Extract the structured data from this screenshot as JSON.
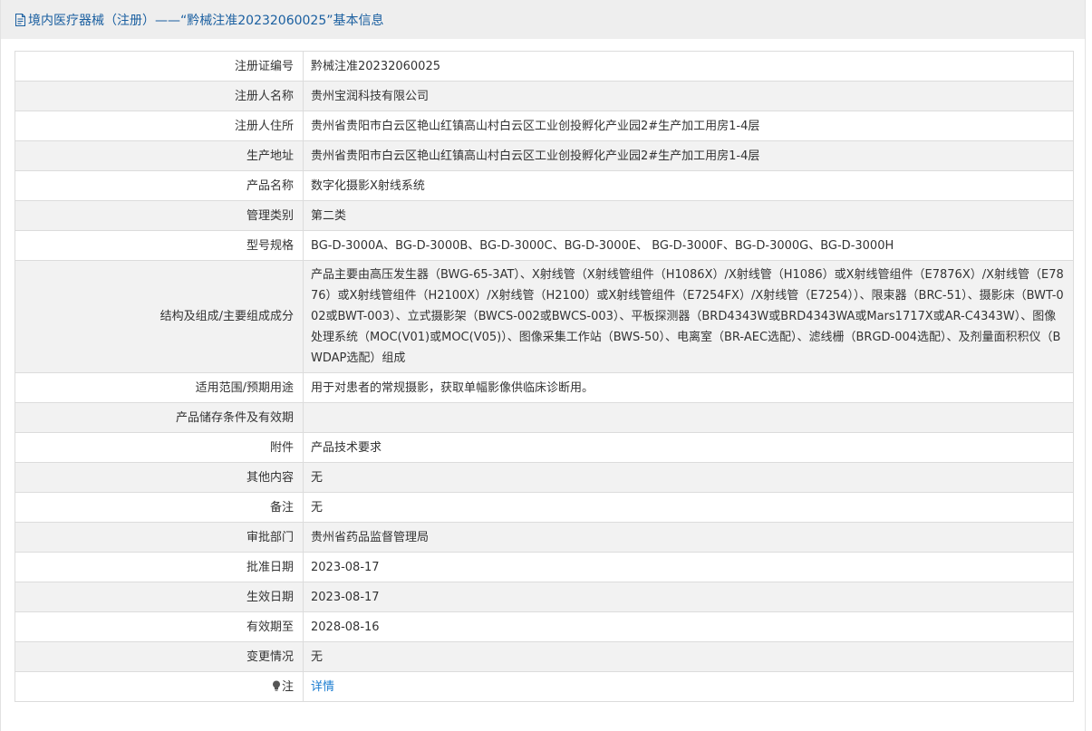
{
  "header": {
    "title": "境内医疗器械（注册）——“黔械注准20232060025”基本信息",
    "icon": "document-icon"
  },
  "rows": [
    {
      "label": "注册证编号",
      "value": "黔械注准20232060025"
    },
    {
      "label": "注册人名称",
      "value": "贵州宝润科技有限公司"
    },
    {
      "label": "注册人住所",
      "value": "贵州省贵阳市白云区艳山红镇高山村白云区工业创投孵化产业园2#生产加工用房1-4层"
    },
    {
      "label": "生产地址",
      "value": "贵州省贵阳市白云区艳山红镇高山村白云区工业创投孵化产业园2#生产加工用房1-4层"
    },
    {
      "label": "产品名称",
      "value": "数字化摄影X射线系统"
    },
    {
      "label": "管理类别",
      "value": "第二类"
    },
    {
      "label": "型号规格",
      "value": "BG-D-3000A、BG-D-3000B、BG-D-3000C、BG-D-3000E、 BG-D-3000F、BG-D-3000G、BG-D-3000H"
    },
    {
      "label": "结构及组成/主要组成成分",
      "value": "产品主要由高压发生器（BWG-65-3AT）、X射线管（X射线管组件（H1086X）/X射线管（H1086）或X射线管组件（E7876X）/X射线管（E7876）或X射线管组件（H2100X）/X射线管（H2100）或X射线管组件（E7254FX）/X射线管（E7254））、限束器（BRC-51）、摄影床（BWT-002或BWT-003）、立式摄影架（BWCS-002或BWCS-003）、平板探测器（BRD4343W或BRD4343WA或Mars1717X或AR-C4343W）、图像处理系统（MOC(V01)或MOC(V05)）、图像采集工作站（BWS-50）、电离室（BR-AEC选配）、滤线栅（BRGD-004选配）、及剂量面积积仪（BWDAP选配）组成"
    },
    {
      "label": "适用范围/预期用途",
      "value": "用于对患者的常规摄影，获取单幅影像供临床诊断用。"
    },
    {
      "label": "产品储存条件及有效期",
      "value": ""
    },
    {
      "label": "附件",
      "value": "产品技术要求"
    },
    {
      "label": "其他内容",
      "value": "无"
    },
    {
      "label": "备注",
      "value": "无"
    },
    {
      "label": "审批部门",
      "value": "贵州省药品监督管理局"
    },
    {
      "label": "批准日期",
      "value": "2023-08-17"
    },
    {
      "label": "生效日期",
      "value": "2023-08-17"
    },
    {
      "label": "有效期至",
      "value": "2028-08-16"
    },
    {
      "label": "变更情况",
      "value": "无"
    }
  ],
  "note": {
    "label": "注",
    "icon": "lightbulb-icon",
    "link_text": "详情"
  }
}
